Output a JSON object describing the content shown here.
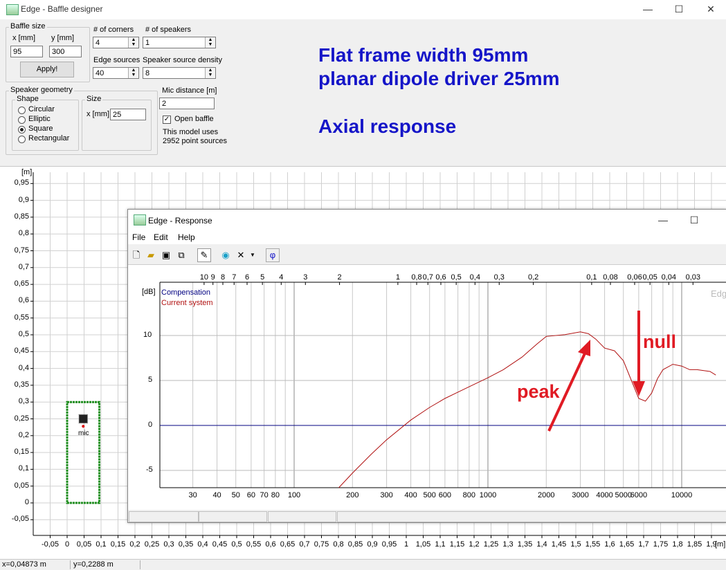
{
  "window": {
    "title": "Edge - Baffle designer",
    "minimize": "—",
    "maximize": "☐",
    "close": "✕"
  },
  "panel": {
    "baffle_size": {
      "label": "Baffle size",
      "x_label": "x [mm]",
      "y_label": "y [mm]",
      "x_value": "95",
      "y_value": "300",
      "apply": "Apply!"
    },
    "corners": {
      "label": "# of corners",
      "value": "4"
    },
    "speakers": {
      "label": "# of speakers",
      "value": "1"
    },
    "edge_sources": {
      "label": "Edge sources",
      "value": "40"
    },
    "source_density": {
      "label": "Speaker source density",
      "value": "8"
    },
    "speaker_geometry": {
      "label": "Speaker geometry",
      "shape_label": "Shape",
      "shapes": [
        "Circular",
        "Elliptic",
        "Square",
        "Rectangular"
      ],
      "selected": "Square",
      "size_label": "Size",
      "size_x_label": "x [mm]",
      "size_value": "25"
    },
    "mic_distance": {
      "label": "Mic distance [m]",
      "value": "2"
    },
    "open_baffle": {
      "label": "Open baffle",
      "checked": true
    },
    "model_info": [
      "This model uses",
      "2952 point sources"
    ],
    "annotation": [
      "Flat frame width 95mm",
      "planar dipole driver 25mm",
      "Axial response"
    ]
  },
  "plot": {
    "y_unit": "[m]",
    "x_unit": "[m]",
    "y_ticks": [
      "0,95",
      "0,9",
      "0,85",
      "0,8",
      "0,75",
      "0,7",
      "0,65",
      "0,6",
      "0,55",
      "0,5",
      "0,45",
      "0,4",
      "0,35",
      "0,3",
      "0,25",
      "0,2",
      "0,15",
      "0,1",
      "0,05",
      "0",
      "-0,05"
    ],
    "x_ticks": [
      "-0,05",
      "0",
      "0,05",
      "0,1",
      "0,15",
      "0,2",
      "0,25",
      "0,3",
      "0,35",
      "0,4",
      "0,45",
      "0,5",
      "0,55",
      "0,6",
      "0,65",
      "0,7",
      "0,75",
      "0,8",
      "0,85",
      "0,9",
      "0,95",
      "1",
      "1,05",
      "1,1",
      "1,15",
      "1,2",
      "1,25",
      "1,3",
      "1,35",
      "1,4",
      "1,45",
      "1,5",
      "1,55",
      "1,6",
      "1,65",
      "1,7",
      "1,75",
      "1,8",
      "1,85",
      "1,9"
    ],
    "mic_label": "mic",
    "baffle_color": "#1a8c1a"
  },
  "status": {
    "x": "x=0,04873 m",
    "y": "y=0,2288 m"
  },
  "response": {
    "title": "Edge - Response",
    "menu": [
      "File",
      "Edit",
      "Help"
    ],
    "toolbar_icons": [
      "new-file-icon",
      "open-folder-icon",
      "save-icon",
      "copy-icon",
      "pen-icon",
      "globe-icon",
      "delete-icon",
      "dropdown-icon",
      "phase-icon"
    ],
    "phase_symbol": "φ",
    "db_unit": "[dB]",
    "legend": {
      "compensation": "Compensation",
      "current": "Current system"
    },
    "watermark": "Edg",
    "curve_color": "#b01010",
    "zero_color": "#000080",
    "annotations": {
      "peak": "peak",
      "null": "null"
    },
    "chart_data": {
      "type": "line",
      "xscale": "log",
      "xlim": [
        20,
        15000
      ],
      "ylim": [
        -7,
        15
      ],
      "y_ticks": [
        10,
        5,
        0,
        -5
      ],
      "freq_tick_labels": [
        "30",
        "40",
        "50",
        "60",
        "70",
        "80",
        "100",
        "200",
        "300",
        "400",
        "500",
        "600",
        "800",
        "1000",
        "2000",
        "3000",
        "4000",
        "5000",
        "6000",
        "10000"
      ],
      "wavelength_tick_labels": [
        "10",
        "9",
        "8",
        "7",
        "6",
        "5",
        "4",
        "3",
        "2",
        "1",
        "0,8",
        "0,7",
        "0,6",
        "0,5",
        "0,4",
        "0,3",
        "0,2",
        "0,1",
        "0,08",
        "0,06",
        "0,05",
        "0,04",
        "0,03"
      ],
      "series": [
        {
          "name": "Compensation",
          "x": [
            20,
            15000
          ],
          "y": [
            0,
            0
          ]
        },
        {
          "name": "Current system",
          "x": [
            170,
            200,
            250,
            300,
            400,
            500,
            600,
            700,
            800,
            1000,
            1200,
            1500,
            1800,
            2000,
            2500,
            3000,
            3300,
            3600,
            4000,
            4500,
            5000,
            5500,
            6000,
            6500,
            7000,
            7500,
            8000,
            9000,
            10000,
            11000,
            12000,
            13000,
            14000,
            15000
          ],
          "y": [
            -7,
            -5.3,
            -3.2,
            -1.6,
            0.6,
            2.0,
            3.0,
            3.7,
            4.3,
            5.3,
            6.2,
            7.6,
            9.1,
            9.9,
            10.1,
            10.4,
            10.2,
            9.6,
            8.6,
            8.3,
            7.2,
            5.0,
            3.0,
            2.7,
            3.6,
            5.2,
            6.2,
            6.8,
            6.6,
            6.2,
            6.2,
            6.1,
            6.0,
            5.6
          ]
        }
      ]
    }
  }
}
